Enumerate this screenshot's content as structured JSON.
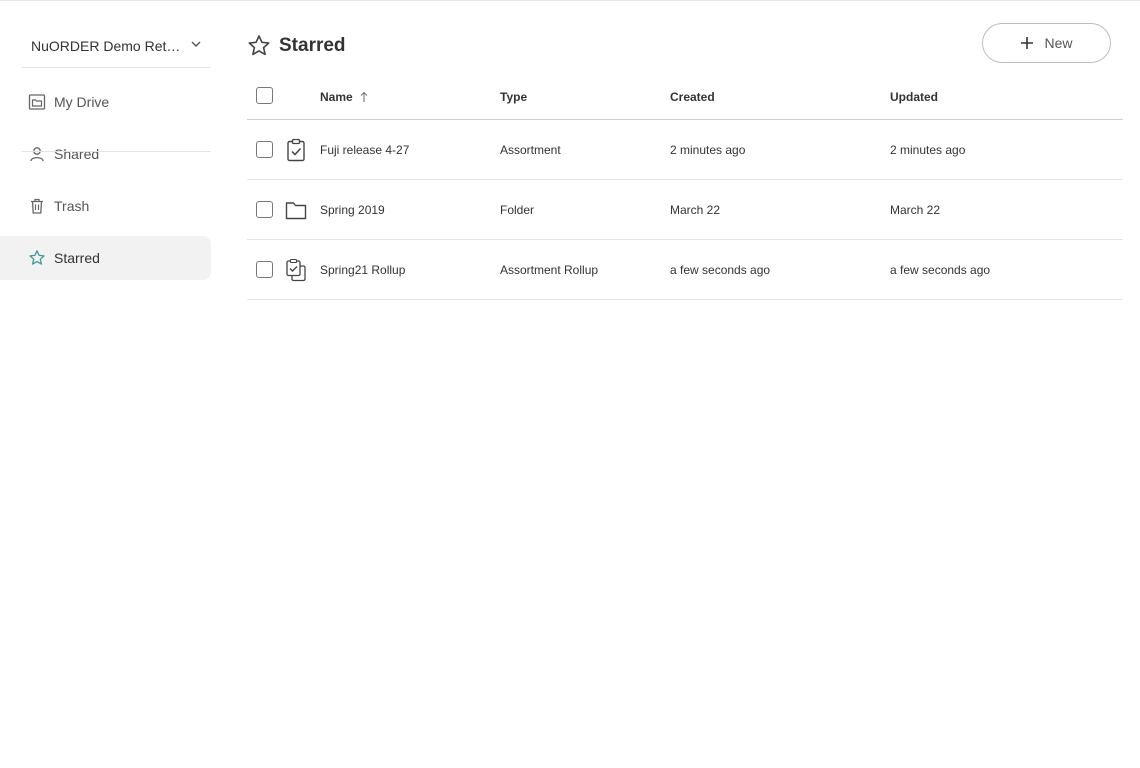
{
  "sidebar": {
    "org_selector": "NuORDER Demo Retailer",
    "items": [
      {
        "label": "My Drive",
        "icon": "drive-folder-icon"
      },
      {
        "label": "Shared",
        "icon": "person-icon"
      },
      {
        "label": "Trash",
        "icon": "trash-icon"
      },
      {
        "label": "Starred",
        "icon": "star-icon",
        "active": true
      }
    ]
  },
  "header": {
    "title": "Starred",
    "new_button_label": "New"
  },
  "table": {
    "columns": {
      "name": "Name",
      "type": "Type",
      "created": "Created",
      "updated": "Updated"
    },
    "sort": {
      "column": "name",
      "direction": "ascending"
    },
    "rows": [
      {
        "name": "Fuji release 4-27",
        "type": "Assortment",
        "created": "2 minutes ago",
        "updated": "2 minutes ago",
        "icon": "clipboard-check-icon"
      },
      {
        "name": "Spring 2019",
        "type": "Folder",
        "created": "March 22",
        "updated": "March 22",
        "icon": "folder-icon"
      },
      {
        "name": "Spring21 Rollup",
        "type": "Assortment Rollup",
        "created": "a few seconds ago",
        "updated": "a few seconds ago",
        "icon": "clipboard-stack-icon"
      }
    ]
  },
  "colors": {
    "active_star": "#3f9a9a",
    "active_nav_bg": "#f2f2f2",
    "text": "#333333"
  }
}
